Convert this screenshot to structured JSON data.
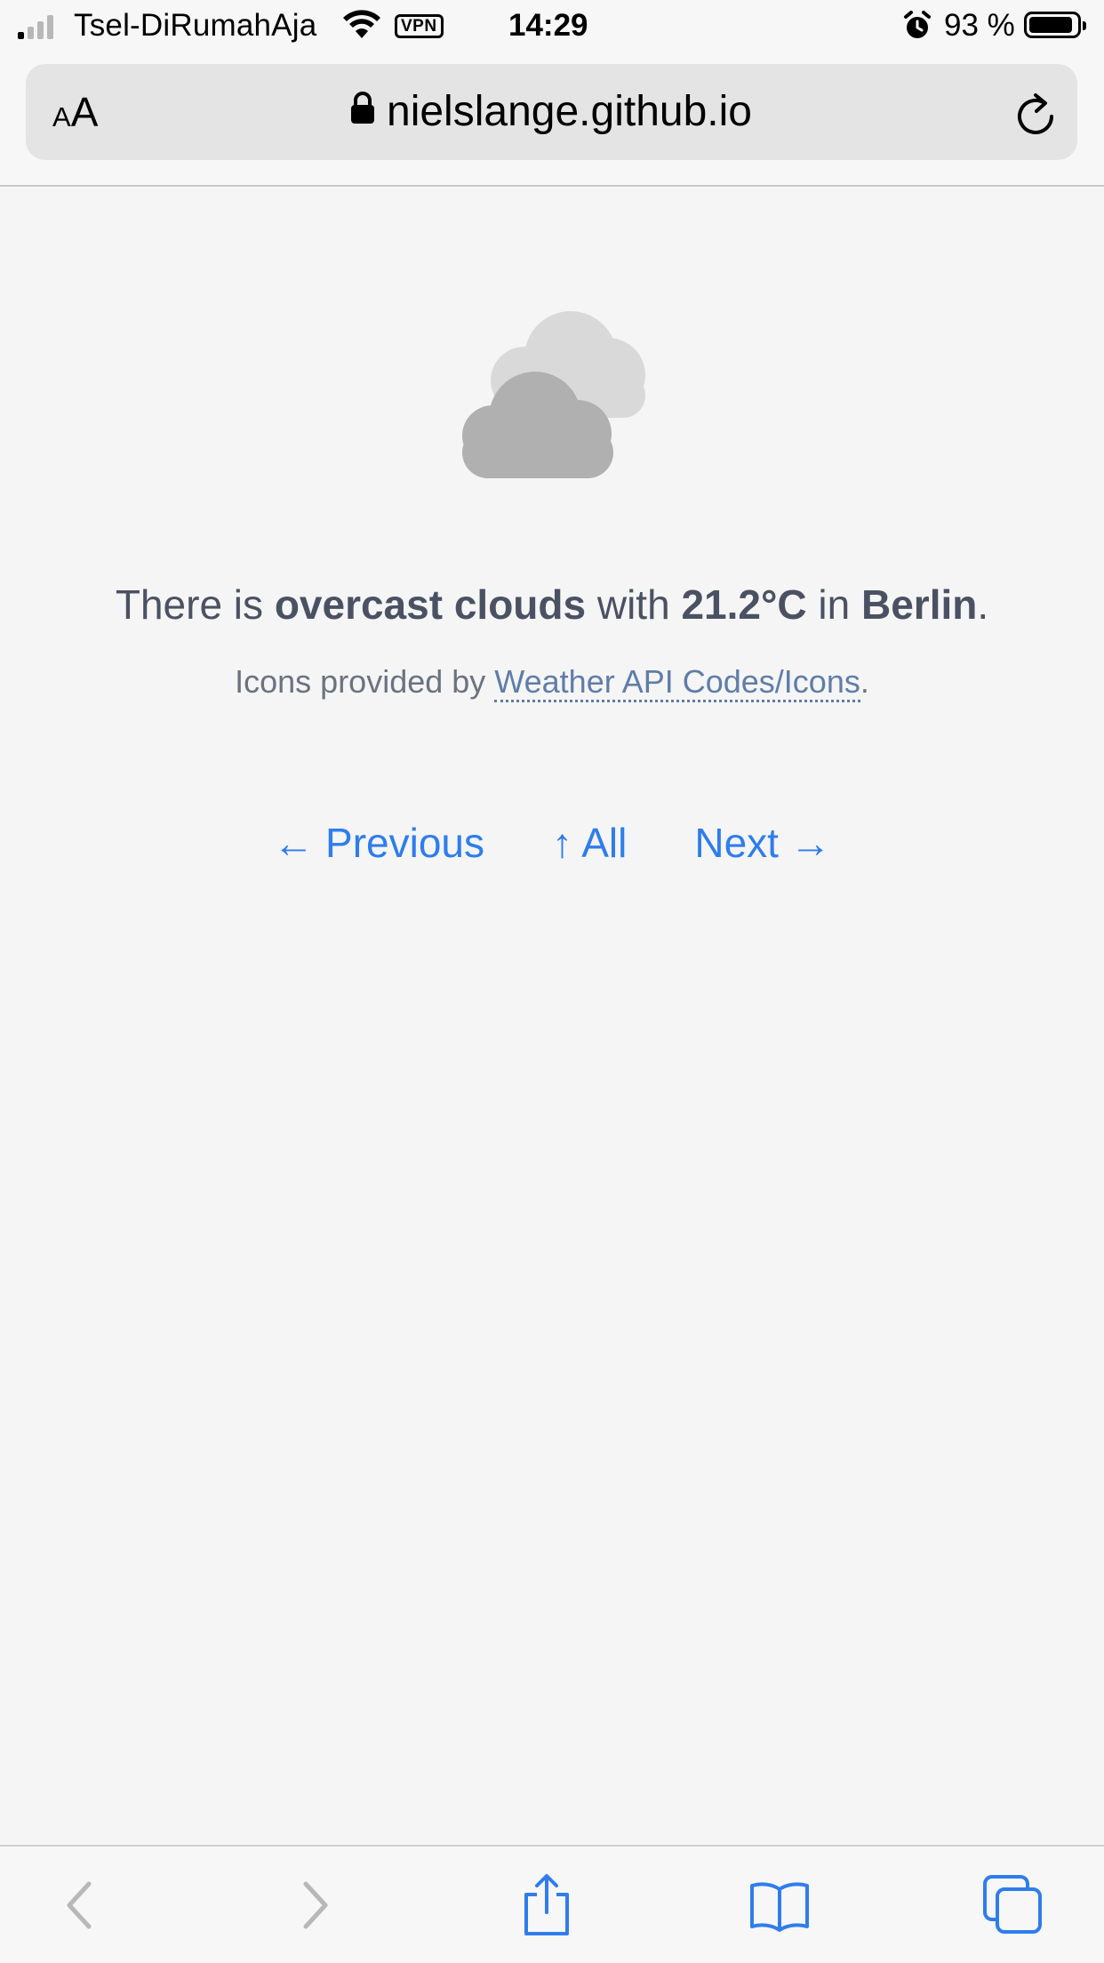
{
  "status_bar": {
    "carrier": "Tsel-DiRumahAja",
    "vpn": "VPN",
    "time": "14:29",
    "battery_percent": "93 %",
    "battery_level": 0.93,
    "signal_bars_active": 1,
    "icons": [
      "signal-icon",
      "wifi-icon",
      "vpn-badge",
      "alarm-icon",
      "battery-icon"
    ]
  },
  "address_bar": {
    "aa_small": "A",
    "aa_large": "A",
    "url": "nielslange.github.io",
    "icons": [
      "lock-icon",
      "reload-icon"
    ]
  },
  "weather": {
    "icon": "overcast-clouds-icon",
    "prefix": "There is ",
    "condition": "overcast clouds",
    "with_text": " with ",
    "temperature": "21.2°C",
    "in_text": " in ",
    "city": "Berlin",
    "end": "."
  },
  "credit": {
    "text": "Icons provided by ",
    "link": "Weather API Codes/Icons",
    "end": "."
  },
  "pager": {
    "previous": "← Previous",
    "all": "↑ All",
    "next": "Next →"
  },
  "toolbar": {
    "icons": [
      "back-icon",
      "forward-icon",
      "share-icon",
      "bookmarks-icon",
      "tabs-icon"
    ]
  },
  "colors": {
    "background": "#f5f5f5",
    "text": "#4a5163",
    "link": "#2f7ded",
    "credit_link": "#5f7da8",
    "toolbar_icon_active": "#2f7ded",
    "toolbar_icon_disabled": "#b8b8b8"
  }
}
